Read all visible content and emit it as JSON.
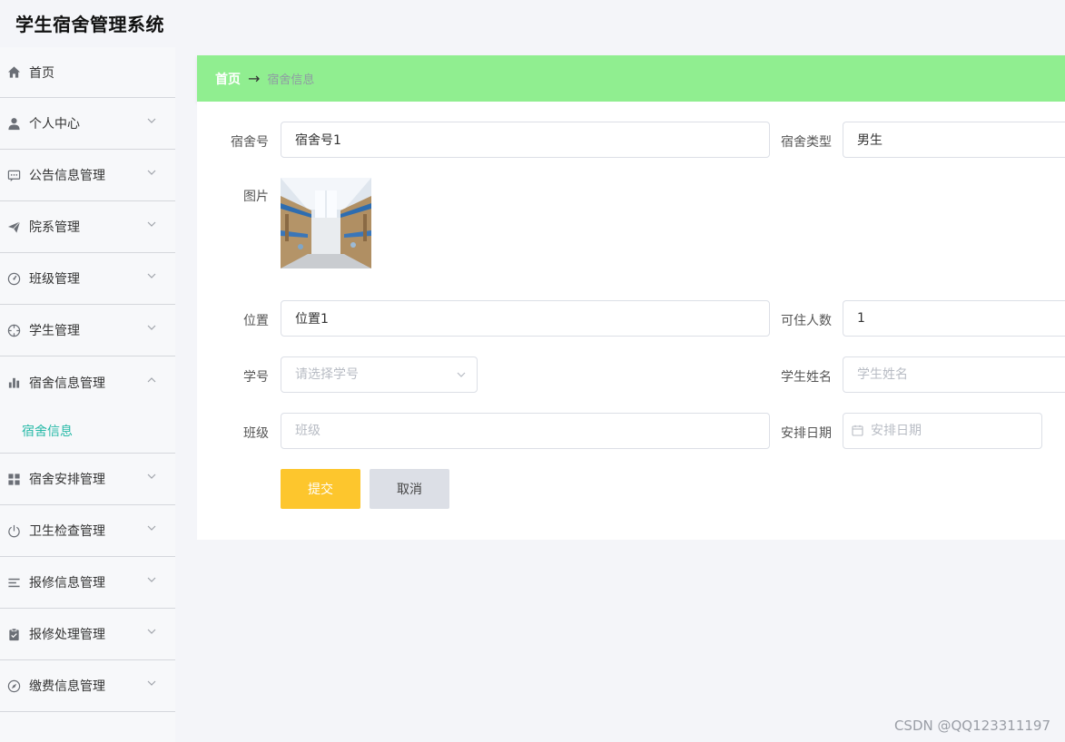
{
  "app": {
    "title": "学生宿舍管理系统"
  },
  "sidebar": {
    "items": [
      {
        "label": "首页",
        "icon": "home-icon",
        "has_arrow": false
      },
      {
        "label": "个人中心",
        "icon": "user-icon",
        "has_arrow": true
      },
      {
        "label": "公告信息管理",
        "icon": "message-icon",
        "has_arrow": true
      },
      {
        "label": "院系管理",
        "icon": "paper-plane-icon",
        "has_arrow": true
      },
      {
        "label": "班级管理",
        "icon": "dashboard-icon",
        "has_arrow": true
      },
      {
        "label": "学生管理",
        "icon": "crosshair-icon",
        "has_arrow": true
      },
      {
        "label": "宿舍信息管理",
        "icon": "bar-chart-icon",
        "has_arrow": true,
        "expanded": true
      },
      {
        "label": "宿舍安排管理",
        "icon": "grid-icon",
        "has_arrow": true
      },
      {
        "label": "卫生检查管理",
        "icon": "power-icon",
        "has_arrow": true
      },
      {
        "label": "报修信息管理",
        "icon": "list-icon",
        "has_arrow": true
      },
      {
        "label": "报修处理管理",
        "icon": "clipboard-icon",
        "has_arrow": true
      },
      {
        "label": "缴费信息管理",
        "icon": "compass-icon",
        "has_arrow": true
      }
    ],
    "submenu": {
      "label": "宿舍信息"
    }
  },
  "breadcrumb": {
    "home": "首页",
    "separator": "→",
    "current": "宿舍信息"
  },
  "form": {
    "dorm_number": {
      "label": "宿舍号",
      "value": "宿舍号1"
    },
    "dorm_type": {
      "label": "宿舍类型",
      "value": "男生"
    },
    "photo": {
      "label": "图片"
    },
    "location": {
      "label": "位置",
      "value": "位置1"
    },
    "capacity": {
      "label": "可住人数",
      "value": "1"
    },
    "student_id": {
      "label": "学号",
      "placeholder": "请选择学号"
    },
    "student_name": {
      "label": "学生姓名",
      "placeholder": "学生姓名"
    },
    "class_name": {
      "label": "班级",
      "placeholder": "班级"
    },
    "arrange_date": {
      "label": "安排日期",
      "placeholder": "安排日期"
    },
    "submit_label": "提交",
    "cancel_label": "取消"
  },
  "watermark": "CSDN @QQ123311197",
  "colors": {
    "breadcrumb_bg": "#90ee90",
    "submit_bg": "#fdc62d",
    "cancel_bg": "#dcdfe6",
    "submenu_active": "#26b9a7"
  }
}
